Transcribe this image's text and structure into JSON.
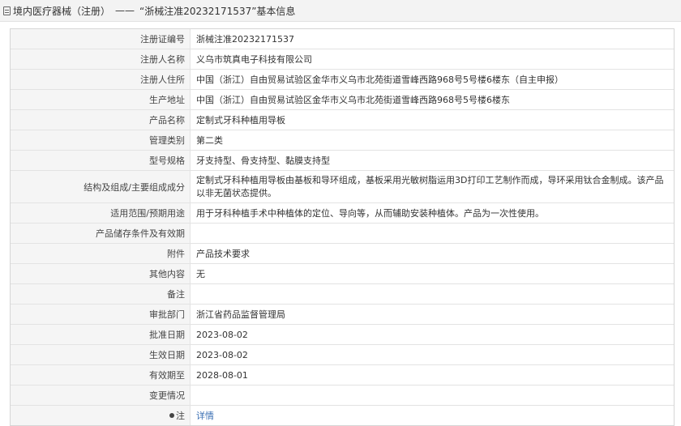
{
  "breadcrumb": {
    "category": "境内医疗器械（注册）",
    "separator": "——",
    "record": "“浙械注准20232171537”基本信息"
  },
  "fields": [
    {
      "label": "注册证编号",
      "value": "浙械注准20232171537"
    },
    {
      "label": "注册人名称",
      "value": "义乌市筑真电子科技有限公司"
    },
    {
      "label": "注册人住所",
      "value": "中国（浙江）自由贸易试验区金华市义乌市北苑街道雪峰西路968号5号楼6楼东（自主申报）"
    },
    {
      "label": "生产地址",
      "value": "中国（浙江）自由贸易试验区金华市义乌市北苑街道雪峰西路968号5号楼6楼东"
    },
    {
      "label": "产品名称",
      "value": "定制式牙科种植用导板"
    },
    {
      "label": "管理类别",
      "value": "第二类"
    },
    {
      "label": "型号规格",
      "value": "牙支持型、骨支持型、黏膜支持型"
    },
    {
      "label": "结构及组成/主要组成成分",
      "value": "定制式牙科种植用导板由基板和导环组成，基板采用光敏树脂运用3D打印工艺制作而成，导环采用钛合金制成。该产品以非无菌状态提供。"
    },
    {
      "label": "适用范围/预期用途",
      "value": "用于牙科种植手术中种植体的定位、导向等，从而辅助安装种植体。产品为一次性使用。"
    },
    {
      "label": "产品储存条件及有效期",
      "value": ""
    },
    {
      "label": "附件",
      "value": "产品技术要求"
    },
    {
      "label": "其他内容",
      "value": "无"
    },
    {
      "label": "备注",
      "value": ""
    },
    {
      "label": "审批部门",
      "value": "浙江省药品监督管理局"
    },
    {
      "label": "批准日期",
      "value": "2023-08-02"
    },
    {
      "label": "生效日期",
      "value": "2023-08-02"
    },
    {
      "label": "有效期至",
      "value": "2028-08-01"
    },
    {
      "label": "变更情况",
      "value": ""
    }
  ],
  "note": {
    "label": "注",
    "link_text": "详情"
  }
}
